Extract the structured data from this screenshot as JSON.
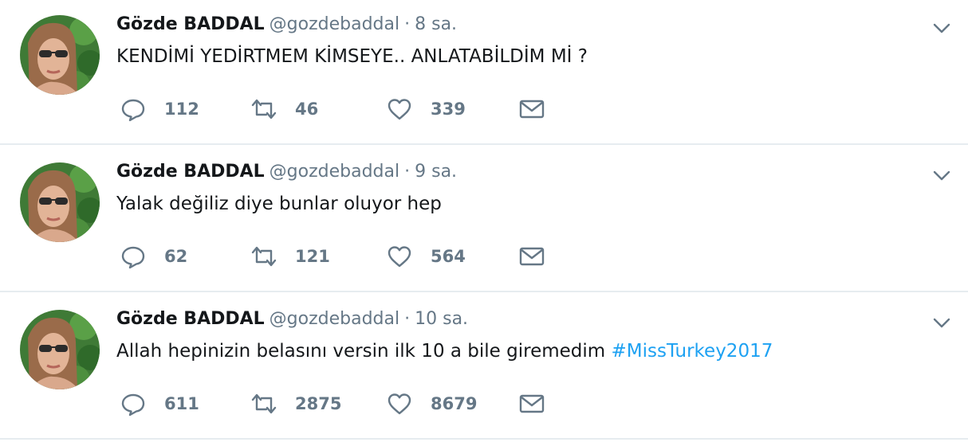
{
  "tweets": [
    {
      "name": "Gözde BADDAL",
      "handle": "@gozdebaddal",
      "separator": "·",
      "time": "8 sa.",
      "text": "KENDİMİ YEDİRTMEM KİMSEYE.. ANLATABİLDİM Mİ ?",
      "hashtag": "",
      "replies": "112",
      "retweets": "46",
      "likes": "339"
    },
    {
      "name": "Gözde BADDAL",
      "handle": "@gozdebaddal",
      "separator": "·",
      "time": "9 sa.",
      "text": "Yalak değiliz diye bunlar oluyor hep",
      "hashtag": "",
      "replies": "62",
      "retweets": "121",
      "likes": "564"
    },
    {
      "name": "Gözde BADDAL",
      "handle": "@gozdebaddal",
      "separator": "·",
      "time": "10 sa.",
      "text": "Allah hepinizin belasını versin ilk 10 a bile giremedim ",
      "hashtag": "#MissTurkey2017",
      "replies": "611",
      "retweets": "2875",
      "likes": "8679"
    }
  ],
  "icons": {
    "reply": "reply-icon",
    "retweet": "retweet-icon",
    "like": "heart-icon",
    "dm": "envelope-icon",
    "menu": "chevron-down-icon"
  },
  "colors": {
    "text": "#14171a",
    "muted": "#657786",
    "hashtag": "#1da1f2",
    "divider": "#e6ecf0"
  }
}
